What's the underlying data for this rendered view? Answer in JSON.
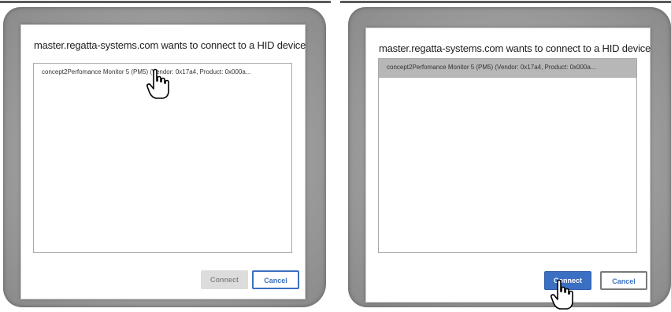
{
  "left_dialog": {
    "title": "master.regatta-systems.com wants to connect to a HID device",
    "devices": [
      {
        "label": "concept2Perfomance Monitor 5 (PM5) (Vendor: 0x17a4, Product: 0x000a...",
        "selected": false
      }
    ],
    "connect_label": "Connect",
    "connect_enabled": false,
    "cancel_label": "Cancel"
  },
  "right_dialog": {
    "title": "master.regatta-systems.com wants to connect to a HID device",
    "devices": [
      {
        "label": "concept2Perfomance Monitor 5 (PM5) (Vendor: 0x17a4, Product: 0x000a...",
        "selected": true
      }
    ],
    "connect_label": "Connect",
    "connect_enabled": true,
    "cancel_label": "Cancel"
  },
  "icons": {
    "cursor": "hand-pointer-icon"
  },
  "colors": {
    "accent": "#3a6fc2",
    "selected_row": "#b7b7b7",
    "disabled_button": "#dcdcdc"
  }
}
